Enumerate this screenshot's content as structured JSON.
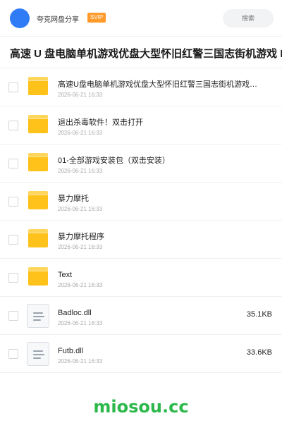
{
  "header": {
    "share_name": "夸克网盘分享",
    "badge": "SVIP",
    "search_placeholder": "搜索"
  },
  "title": "高速 U 盘电脑单机游戏优盘大型怀旧红警三国志街机游戏 PC",
  "items": [
    {
      "type": "folder",
      "name": "高速U盘电脑单机游戏优盘大型怀旧红警三国志街机游戏合集",
      "date": "2026-06-21 16:33",
      "size": ""
    },
    {
      "type": "folder",
      "name": "退出杀毒软件！双击打开",
      "date": "2026-06-21 16:33",
      "size": ""
    },
    {
      "type": "folder",
      "name": "01-全部游戏安装包（双击安装）",
      "date": "2026-06-21 16:33",
      "size": ""
    },
    {
      "type": "folder",
      "name": "暴力摩托",
      "date": "2026-06-21 16:33",
      "size": ""
    },
    {
      "type": "folder",
      "name": "暴力摩托程序",
      "date": "2026-06-21 16:33",
      "size": ""
    },
    {
      "type": "folder",
      "name": "Text",
      "date": "2026-06-21 16:33",
      "size": ""
    },
    {
      "type": "file",
      "name": "Badloc.dll",
      "date": "2026-06-21 16:33",
      "size": "35.1KB"
    },
    {
      "type": "file",
      "name": "Futb.dll",
      "date": "2026-06-21 16:33",
      "size": "33.6KB"
    }
  ],
  "footer": {
    "brand": "miosou.cc"
  },
  "colors": {
    "accent": "#2f7cf6",
    "badge": "#ff9a2b",
    "folder": "#ffc21a",
    "brand": "#2db84b"
  },
  "icons": {
    "folder": "folder-icon",
    "file": "file-icon"
  }
}
